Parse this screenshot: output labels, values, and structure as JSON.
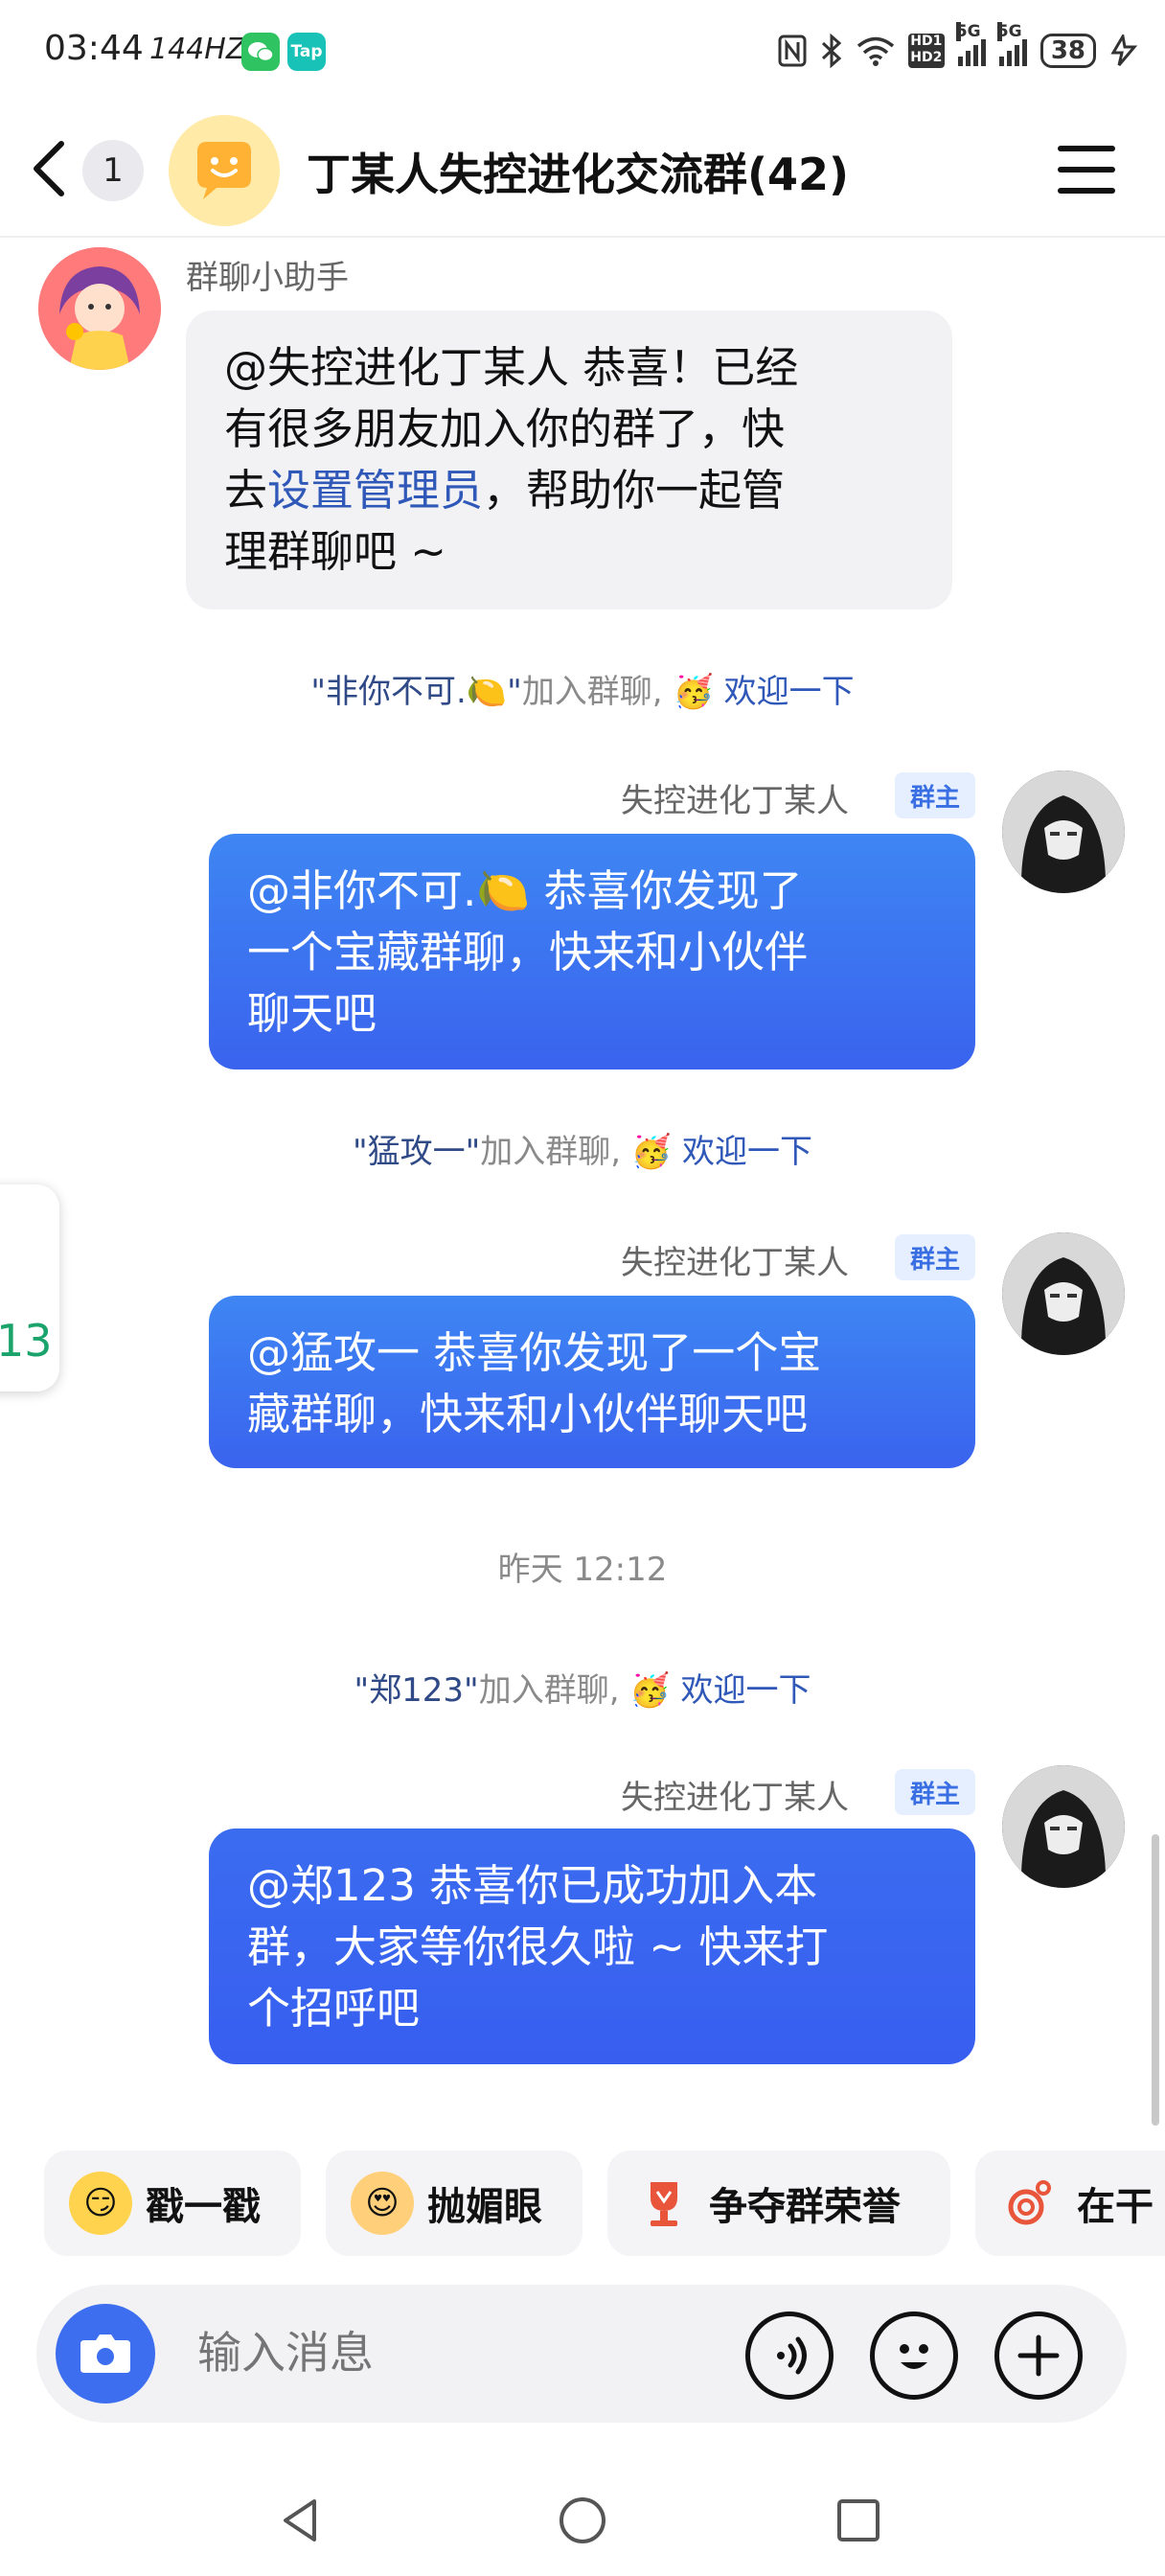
{
  "status_bar": {
    "time": "03:44",
    "refresh_rate": "144HZ",
    "app_badge_tap": "Tap",
    "battery": "38",
    "network_5g_1": "5G",
    "network_5g_2": "5G",
    "hd": "HD"
  },
  "header": {
    "unread_count": "1",
    "title": "丁某人失控进化交流群(42)"
  },
  "messages": {
    "assistant_name": "群聊小助手",
    "assistant_text_1": "@失控进化丁某人 恭喜！已经",
    "assistant_text_2": "有很多朋友加入你的群了，快",
    "assistant_text_3_prefix": "去",
    "assistant_text_3_link": "设置管理员",
    "assistant_text_3_suffix": "，帮助你一起管",
    "assistant_text_4": "理群聊吧 ~",
    "sys1_nick": "\"非你不可.🍋\"",
    "sys_join": "加入群聊,",
    "sys_welcome": "欢迎一下",
    "owner_name": "失控进化丁某人",
    "owner_badge": "群主",
    "msg1_line1": "@非你不可.🍋 恭喜你发现了",
    "msg1_line2": "一个宝藏群聊，快来和小伙伴",
    "msg1_line3": "聊天吧",
    "sys2_nick": "\"猛攻一\"",
    "msg2_line1": "@猛攻一 恭喜你发现了一个宝",
    "msg2_line2": "藏群聊，快来和小伙伴聊天吧",
    "timestamp": "昨天 12:12",
    "sys3_nick": "\"郑123\"",
    "msg3_line1": "@郑123 恭喜你已成功加入本",
    "msg3_line2": "群，大家等你很久啦 ~ 快来打",
    "msg3_line3": "个招呼吧"
  },
  "side_widget": {
    "text": "13"
  },
  "quick_actions": {
    "chip1": "戳一戳",
    "chip2": "抛媚眼",
    "chip3": "争夺群荣誉",
    "chip4": "在干"
  },
  "input": {
    "placeholder": "输入消息"
  },
  "colors": {
    "accent_blue": "#3d6ef0",
    "bubble_gray": "#f2f2f5",
    "link_blue": "#2f58b8",
    "side_green": "#1aa36a"
  }
}
